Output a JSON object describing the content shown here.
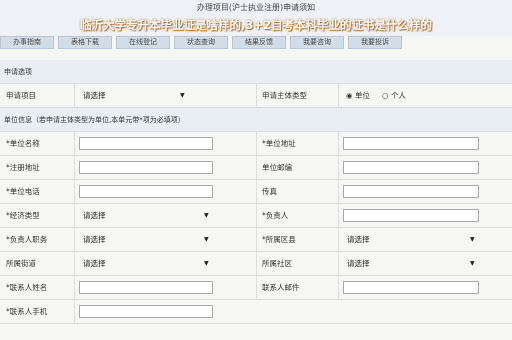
{
  "header": {
    "title": "办理项目(沪士执业注册)申请须知",
    "overlay_title": "临沂大学专升本毕业证是啥样的,3+2自考本科毕业的证书是什么样的"
  },
  "tabs": [
    "办事指南",
    "表格下载",
    "在线登记",
    "状态查询",
    "结果反馈",
    "我要咨询",
    "我要投诉"
  ],
  "sections": {
    "apply": "申请选项",
    "unit_info": "单位信息（若申请主体类型为单位,本单元带*项为必填项）"
  },
  "apply_row": {
    "label1": "申请项目",
    "select1": "请选择",
    "label2": "申请主体类型",
    "radio1": "单位",
    "radio2": "个人"
  },
  "fields": {
    "unit_name": "*单位名称",
    "unit_address": "*单位地址",
    "reg_address": "*注册地址",
    "unit_email": "单位邮编",
    "unit_phone": "*单位电话",
    "fax": "传真",
    "economy_type": "*经济类型",
    "economy_select": "请选择",
    "leader": "*负责人",
    "leader_duty": "*负责人职务",
    "leader_duty_select": "请选择",
    "district": "*所属区县",
    "district_select": "请选择",
    "street": "所属街道",
    "street_select": "请选择",
    "community": "所属社区",
    "community_select": "请选择",
    "contact_name": "*联系人姓名",
    "contact_email": "联系人邮件",
    "contact_mobile": "*联系人手机"
  },
  "icons": {
    "dropdown": "triangle-down",
    "radio_on": "radio-checked",
    "radio_off": "radio-empty"
  }
}
